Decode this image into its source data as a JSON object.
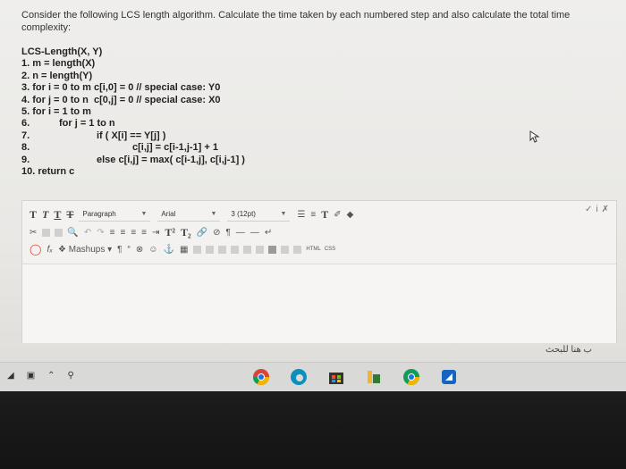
{
  "question": {
    "text": "Consider the following LCS length algorithm. Calculate the time taken by each numbered step and also calculate the total time complexity:"
  },
  "code": {
    "lines": [
      {
        "num": "",
        "text": "LCS-Length(X, Y)"
      },
      {
        "num": "",
        "text": "1. m = length(X)"
      },
      {
        "num": "",
        "text": "2. n = length(Y)"
      },
      {
        "num": "",
        "text": "3. for i = 0 to m c[i,0] = 0 // special case: Y0"
      },
      {
        "num": "",
        "text": "4. for j = 0 to n  c[0,j] = 0 // special case: X0"
      },
      {
        "num": "",
        "text": "5. for i = 1 to m"
      },
      {
        "num": "6.",
        "text": "for j = 1 to n"
      },
      {
        "num": "7.",
        "text": "if ( X[i] == Y[j] )"
      },
      {
        "num": "8.",
        "text": "c[i,j] = c[i-1,j-1] + 1"
      },
      {
        "num": "9.",
        "text": "else c[i,j] = max( c[i-1,j], c[i,j-1] )"
      },
      {
        "num": "",
        "text": "10. return c"
      }
    ]
  },
  "toolbar": {
    "format_buttons": [
      "T",
      "T",
      "T",
      "T"
    ],
    "paragraph_select": "Paragraph",
    "font_select": "Arial",
    "size_select": "3 (12pt)",
    "mashups_label": "Mashups",
    "html_label": "HTML",
    "css_label": "CSS"
  },
  "search_label": "ب هنا للبحث",
  "colors": {
    "accent": "#e0462f",
    "chrome_blue": "#1a73e8",
    "edge_teal": "#0c8fbd"
  },
  "icons": [
    "search-icon",
    "cursor-icon",
    "chrome-icon",
    "edge-icon",
    "store-icon",
    "files-icon",
    "outlook-icon"
  ]
}
